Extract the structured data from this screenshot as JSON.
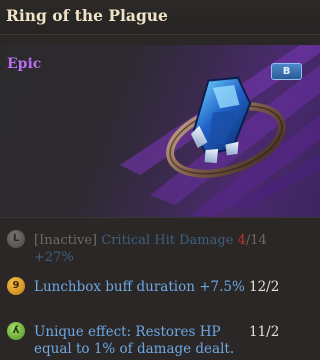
{
  "item": {
    "name": "Ring of the Plague",
    "rarity": "Epic",
    "grade": "B"
  },
  "stats": [
    {
      "icon": "inactive-rune-icon",
      "prefix": "[Inactive]",
      "label": "Critical Hit Damage",
      "value_current": "4",
      "value_max": "/14",
      "bonus": "+27%"
    },
    {
      "icon": "orange-rune-icon",
      "label": "Lunchbox buff duration +7.5%",
      "value": "12/2"
    },
    {
      "icon": "green-rune-icon",
      "label_line1": "Unique effect: Restores HP",
      "label_line2": "equal to 1% of damage dealt.",
      "value": "11/2"
    }
  ],
  "colors": {
    "rarity_epic": "#b86cf2",
    "inactive_text": "#6f6a66",
    "inactive_accent": "#3e607f",
    "value_red": "#c0332b",
    "active_blue": "#6fa8e3"
  }
}
